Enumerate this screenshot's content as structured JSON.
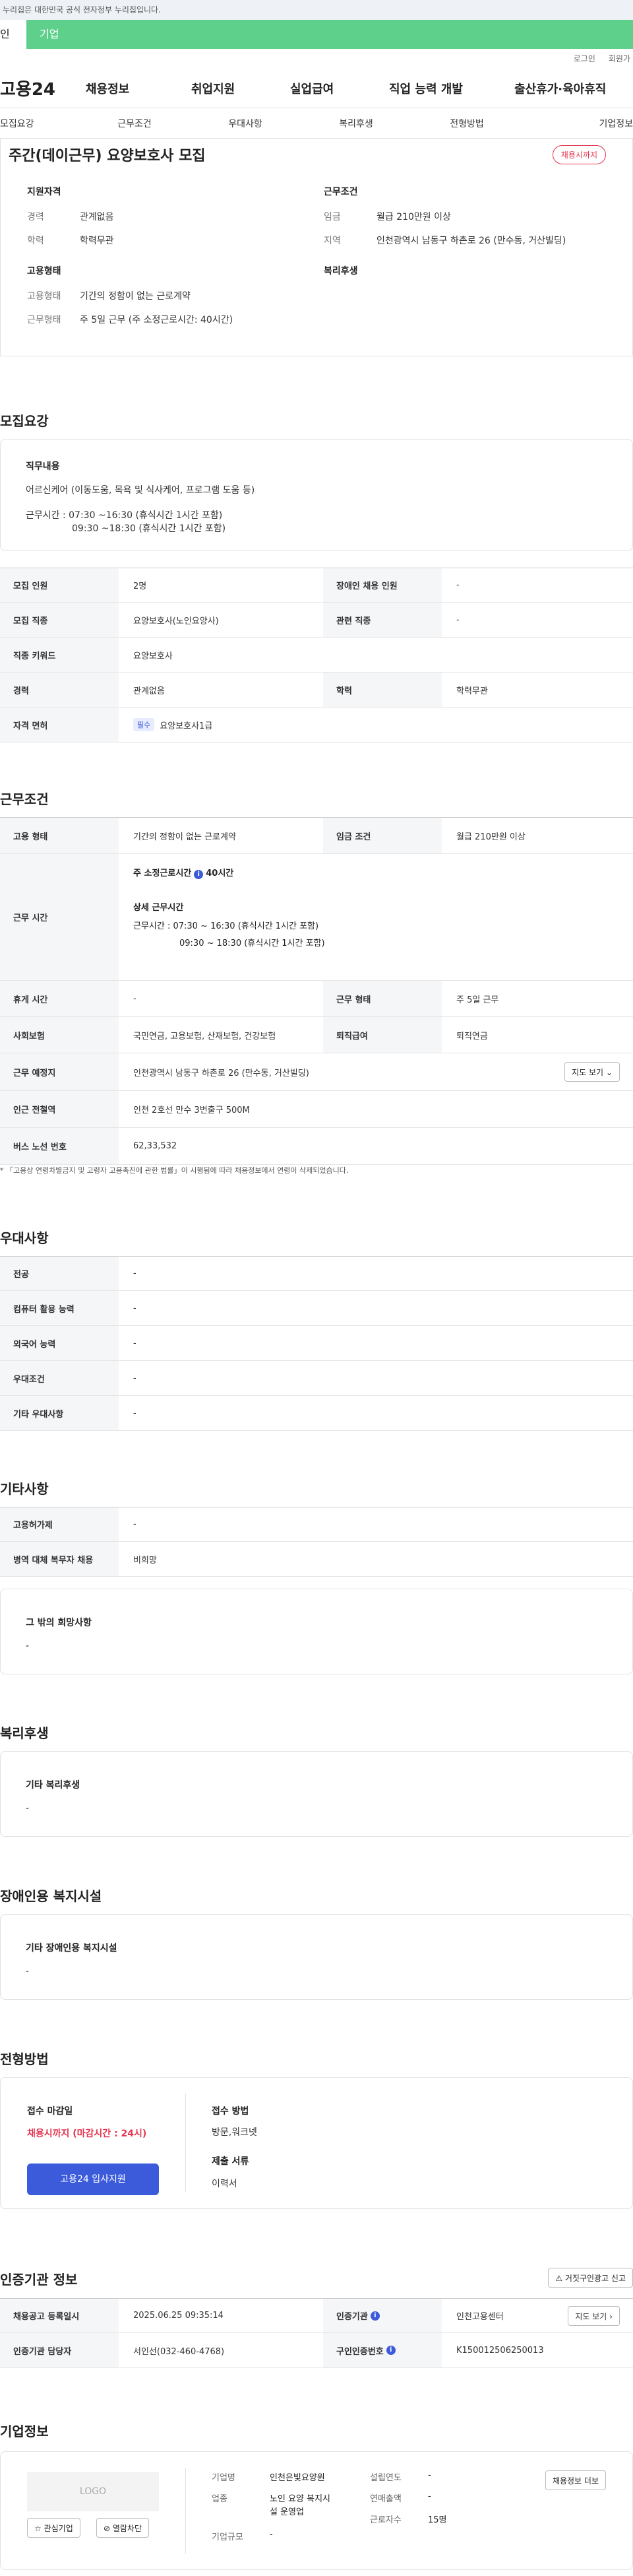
{
  "gov_notice": "누리집은 대한민국 공식 전자정부 누리집입니다.",
  "tabs": {
    "personal": "인",
    "business": "기업"
  },
  "util": {
    "login": "로그인",
    "join": "회원가"
  },
  "gnb": {
    "logo": "고용24",
    "menu": [
      "채용정보",
      "취업지원",
      "실업급여",
      "직업 능력 개발",
      "출산휴가·육아휴직"
    ]
  },
  "lnb": [
    "모집요강",
    "근무조건",
    "우대사항",
    "복리후생",
    "전형방법",
    "기업정보"
  ],
  "summary": {
    "title": "주간(데이근무) 요양보호사 모집",
    "badge": "채용시까지",
    "qual_head": "지원자격",
    "career_k": "경력",
    "career_v": "관계없음",
    "edu_k": "학력",
    "edu_v": "학력무관",
    "cond_head": "근무조건",
    "wage_k": "임금",
    "wage_v": "월급 210만원 이상",
    "area_k": "지역",
    "area_v": "인천광역시 남동구 하촌로 26 (만수동, 거산빌딩)",
    "emp_head": "고용형태",
    "type_k": "고용형태",
    "type_v": "기간의 정함이 없는 근로계약",
    "hours_k": "근무형태",
    "hours_v": "주 5일 근무 (주 소정근로시간: 40시간)",
    "welfare_head": "복리후생"
  },
  "recruit": {
    "title": "모집요강",
    "duty_head": "직무내용",
    "duty_text": "어르신케어 (이동도움, 목욕 및 식사케어, 프로그램 도움 등)",
    "time1": "근무시간 : 07:30 ~16:30 (휴식시간 1시간 포함)",
    "time2": "09:30 ~18:30 (휴식시간 1시간 포함)",
    "rows": [
      {
        "k1": "모집 인원",
        "v1": "2명",
        "k2": "장애인 채용 인원",
        "v2": "-"
      },
      {
        "k1": "모집 직종",
        "v1": "요양보호사(노인요양사)",
        "k2": "관련 직종",
        "v2": "-"
      },
      {
        "k1": "직종 키워드",
        "v1": "요양보호사"
      },
      {
        "k1": "경력",
        "v1": "관계없음",
        "k2": "학력",
        "v2": "학력무관"
      }
    ],
    "license_k": "자격 면허",
    "license_tag": "필수",
    "license_v": "요양보호사1급"
  },
  "work": {
    "title": "근무조건",
    "type_k": "고용 형태",
    "type_v": "기간의 정함이 없는 근로계약",
    "wage_k": "임금 조건",
    "wage_v": "월급 210만원 이상",
    "time_k": "근무 시간",
    "weekly_label": "주 소정근로시간",
    "weekly_v": "40시간",
    "detail_head": "상세 근무시간",
    "detail1": "근무시간 : 07:30 ~ 16:30 (휴식시간 1시간 포함)",
    "detail2": "09:30 ~ 18:30 (휴식시간 1시간 포함)",
    "rest_k": "휴게 시간",
    "rest_v": "-",
    "form_k": "근무 형태",
    "form_v": "주 5일 근무",
    "ins_k": "사회보험",
    "ins_v": "국민연금, 고용보험, 산재보험, 건강보험",
    "sev_k": "퇴직급여",
    "sev_v": "퇴직연금",
    "loc_k": "근무 예정지",
    "loc_v": "인천광역시 남동구 하촌로 26 (만수동, 거산빌딩)",
    "map_btn": "지도 보기",
    "sub_k": "인근 전철역",
    "sub_v": "인천 2호선 만수 3번출구 500M",
    "bus_k": "버스 노선 번호",
    "bus_v": "62,33,532",
    "notice": "* 「고용상 연령차별금지 및 고령자 고용촉진에 관한 법률」이 시행됨에 따라 채용정보에서 연령이 삭제되었습니다."
  },
  "pref": {
    "title": "우대사항",
    "rows": [
      {
        "k": "전공",
        "v": "-"
      },
      {
        "k": "컴퓨터 활용 능력",
        "v": "-"
      },
      {
        "k": "외국어 능력",
        "v": "-"
      },
      {
        "k": "우대조건",
        "v": "-"
      },
      {
        "k": "기타 우대사항",
        "v": "-"
      }
    ]
  },
  "etc": {
    "title": "기타사항",
    "rows": [
      {
        "k": "고용허가제",
        "v": "-"
      },
      {
        "k": "병역 대체 복무자 채용",
        "v": "비희망"
      }
    ],
    "hope_head": "그 밖의 희망사항",
    "hope_v": "-"
  },
  "welfare": {
    "title": "복리후생",
    "head": "기타 복리후생",
    "v": "-"
  },
  "disabled": {
    "title": "장애인용 복지시설",
    "head": "기타 장애인용 복지시설",
    "v": "-"
  },
  "process": {
    "title": "전형방법",
    "deadline_head": "접수 마감일",
    "deadline_v": "채용시까지 (마감시간 : 24시)",
    "method_head": "접수 방법",
    "method_v": "방문,워크넷",
    "docs_head": "제출 서류",
    "docs_v": "이력서",
    "apply_btn": "고용24 입사지원"
  },
  "cert": {
    "title": "인증기관 정보",
    "report_btn": "거짓구인광고 신고",
    "reg_k": "채용공고 등록일시",
    "reg_v": "2025.06.25 09:35:14",
    "agency_k": "인증기관",
    "agency_v": "인천고용센터",
    "map_btn": "지도 보기",
    "mgr_k": "인증기관 담당자",
    "mgr_v": "서인선(032-460-4768)",
    "no_k": "구인인증번호",
    "no_v": "K150012506250013"
  },
  "company": {
    "title": "기업정보",
    "logo": "LOGO",
    "fav_btn": "관심기업",
    "block_btn": "열람차단",
    "name_k": "기업명",
    "name_v": "인천은빛요양원",
    "biz_k": "업종",
    "biz_v1": "노인 요양 복지시",
    "biz_v2": "설 운영업",
    "size_k": "기업규모",
    "size_v": "-",
    "year_k": "설립연도",
    "year_v": "-",
    "sales_k": "연매출액",
    "sales_v": "-",
    "emp_k": "근로자수",
    "emp_v": "15명",
    "jobs_btn": "채용정보 더보"
  }
}
